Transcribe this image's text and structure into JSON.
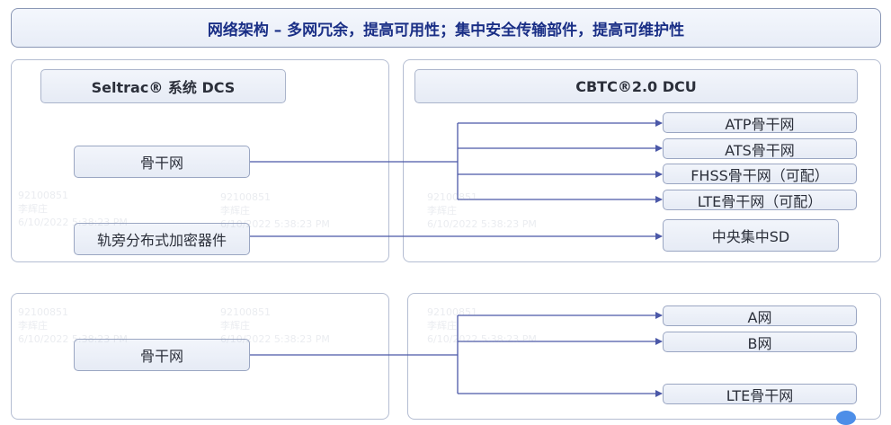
{
  "title": "网络架构 – 多网冗余，提高可用性；集中安全传输部件，提高可维护性",
  "top": {
    "left_header": "Seltrac® 系统 DCS",
    "right_header": "CBTC®2.0 DCU",
    "left_nodes": [
      "骨干网",
      "轨旁分布式加密器件"
    ],
    "right_nodes": [
      "ATP骨干网",
      "ATS骨干网",
      "FHSS骨干网（可配）",
      "LTE骨干网（可配）",
      "中央集中SD"
    ]
  },
  "bottom": {
    "left_node": "骨干网",
    "right_nodes": [
      "A网",
      "B网",
      "LTE骨干网"
    ]
  },
  "watermark": [
    "92100851",
    "李辉庄",
    "6/10/2022 5:38:23 PM"
  ],
  "colors": {
    "title_text": "#1a2f86",
    "line": "#4b58a8",
    "group_border": "#b4bdd2",
    "box_border": "#9aa6c2",
    "box_fill": "#e9eef7"
  }
}
